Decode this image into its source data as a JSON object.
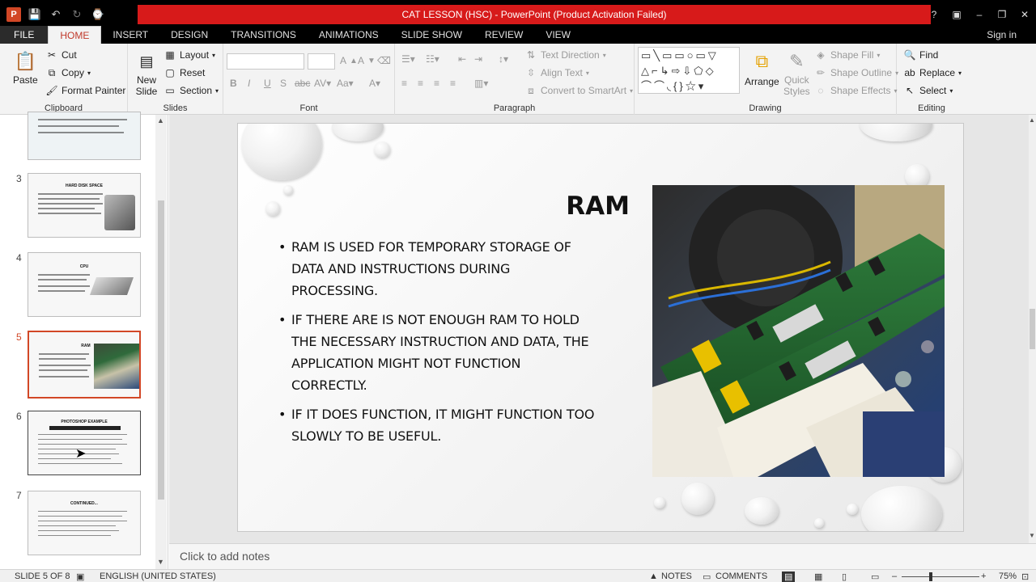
{
  "window": {
    "title": "CAT LESSON (HSC) - PowerPoint (Product Activation Failed)",
    "help": "?",
    "min": "–",
    "max": "❐",
    "close": "✕"
  },
  "tabs": {
    "items": [
      "FILE",
      "HOME",
      "INSERT",
      "DESIGN",
      "TRANSITIONS",
      "ANIMATIONS",
      "SLIDE SHOW",
      "REVIEW",
      "VIEW"
    ],
    "active": "HOME",
    "signin": "Sign in"
  },
  "ribbon": {
    "clipboard": {
      "label": "Clipboard",
      "paste": "Paste",
      "cut": "Cut",
      "copy": "Copy",
      "format_painter": "Format Painter"
    },
    "slides": {
      "label": "Slides",
      "new_slide_1": "New",
      "new_slide_2": "Slide",
      "layout": "Layout",
      "reset": "Reset",
      "section": "Section"
    },
    "font": {
      "label": "Font"
    },
    "paragraph": {
      "label": "Paragraph",
      "text_direction": "Text Direction",
      "align_text": "Align Text",
      "convert_smartart": "Convert to SmartArt"
    },
    "drawing": {
      "label": "Drawing",
      "arrange": "Arrange",
      "quick_styles_1": "Quick",
      "quick_styles_2": "Styles",
      "shape_fill": "Shape Fill",
      "shape_outline": "Shape Outline",
      "shape_effects": "Shape Effects"
    },
    "editing": {
      "label": "Editing",
      "find": "Find",
      "replace": "Replace",
      "select": "Select"
    }
  },
  "thumbnails": [
    {
      "num": "3",
      "title": "HARD DISK SPACE"
    },
    {
      "num": "4",
      "title": "CPU"
    },
    {
      "num": "5",
      "title": "RAM"
    },
    {
      "num": "6",
      "title": "PHOTOSHOP EXAMPLE"
    },
    {
      "num": "7",
      "title": "CONTINUED..."
    }
  ],
  "slide": {
    "title": "RAM",
    "bullets": [
      "RAM IS USED FOR TEMPORARY STORAGE OF DATA AND INSTRUCTIONS DURING PROCESSING.",
      "IF THERE ARE IS NOT ENOUGH RAM TO HOLD THE NECESSARY INSTRUCTION AND DATA, THE APPLICATION MIGHT NOT FUNCTION CORRECTLY.",
      "IF IT DOES FUNCTION, IT MIGHT FUNCTION TOO SLOWLY TO BE USEFUL."
    ]
  },
  "notes": {
    "placeholder": "Click to add notes"
  },
  "status": {
    "slide_count": "SLIDE 5 OF 8",
    "language": "ENGLISH (UNITED STATES)",
    "notes": "NOTES",
    "comments": "COMMENTS",
    "zoom": "75%"
  },
  "colors": {
    "accent": "#d24726",
    "titlebar": "#d71a1a"
  }
}
